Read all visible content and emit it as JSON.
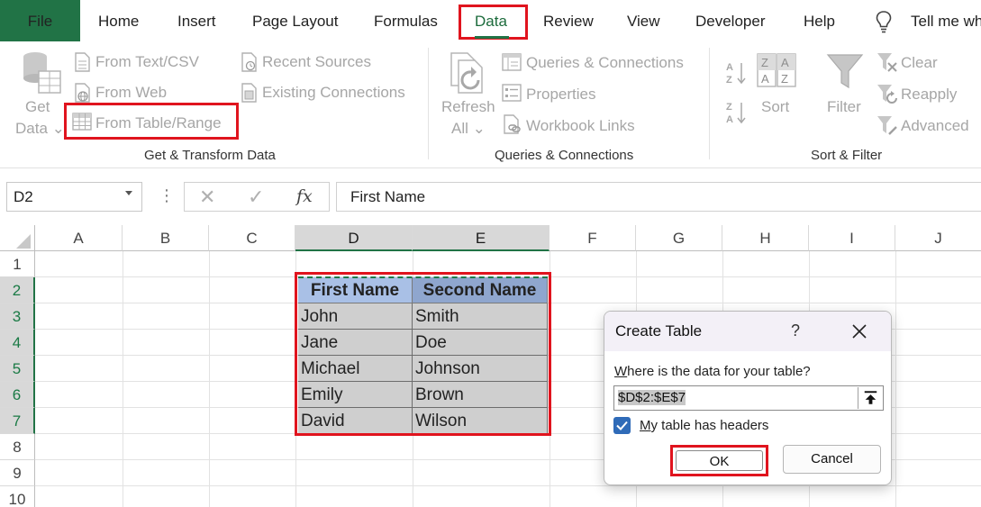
{
  "tabs": {
    "file": "File",
    "home": "Home",
    "insert": "Insert",
    "page_layout": "Page Layout",
    "formulas": "Formulas",
    "data": "Data",
    "review": "Review",
    "view": "View",
    "developer": "Developer",
    "help": "Help",
    "tell_me": "Tell me wh"
  },
  "ribbon": {
    "get_transform": {
      "get_data_line1": "Get",
      "get_data_line2": "Data ⌄",
      "from_text_csv": "From Text/CSV",
      "from_web": "From Web",
      "from_table_range": "From Table/Range",
      "recent_sources": "Recent Sources",
      "existing_connections": "Existing Connections",
      "group_label": "Get & Transform Data"
    },
    "queries": {
      "refresh_line1": "Refresh",
      "refresh_line2": "All ⌄",
      "queries_connections": "Queries & Connections",
      "properties": "Properties",
      "workbook_links": "Workbook Links",
      "group_label": "Queries & Connections"
    },
    "sort_filter": {
      "sort": "Sort",
      "filter": "Filter",
      "clear": "Clear",
      "reapply": "Reapply",
      "advanced": "Advanced",
      "group_label": "Sort & Filter"
    }
  },
  "formula_bar": {
    "name_box": "D2",
    "content": "First Name",
    "fx": "fx",
    "cancel": "✕",
    "enter": "✓",
    "dots": "⋮"
  },
  "grid": {
    "columns": [
      "A",
      "B",
      "C",
      "D",
      "E",
      "F",
      "G",
      "H",
      "I",
      "J"
    ],
    "rows": [
      "1",
      "2",
      "3",
      "4",
      "5",
      "6",
      "7",
      "8",
      "9",
      "10"
    ],
    "table": {
      "headers": [
        "First Name",
        "Second Name"
      ],
      "rows": [
        [
          "John",
          "Smith"
        ],
        [
          "Jane",
          "Doe"
        ],
        [
          "Michael",
          "Johnson"
        ],
        [
          "Emily",
          "Brown"
        ],
        [
          "David",
          "Wilson"
        ]
      ]
    }
  },
  "dialog": {
    "title": "Create Table",
    "help": "?",
    "prompt_underlined": "W",
    "prompt_rest": "here is the data for your table?",
    "range_value": "$D$2:$E$7",
    "checkbox_checked": true,
    "checkbox_label_underlined": "M",
    "checkbox_label_rest": "y table has headers",
    "ok": "OK",
    "cancel": "Cancel"
  },
  "colors": {
    "accent_green": "#217346",
    "highlight_red": "#e0141e",
    "header_blue": "#a9c0e6",
    "selection_gray": "#cfcfcf",
    "checkbox_blue": "#2f6bb8"
  }
}
